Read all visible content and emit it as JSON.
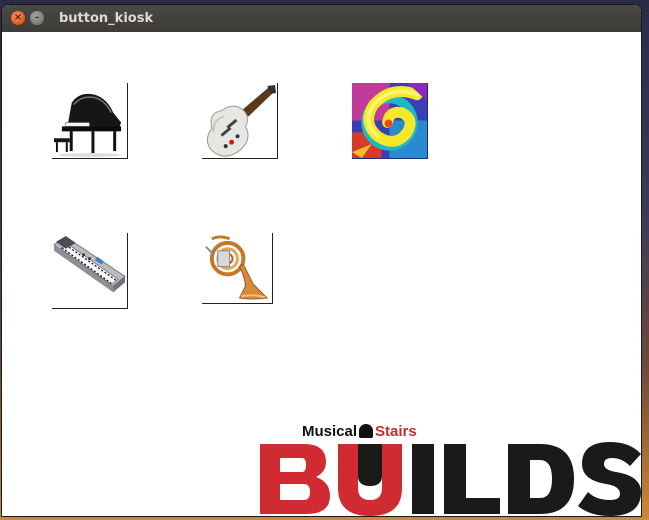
{
  "window": {
    "title": "button_kiosk",
    "close_glyph": "×",
    "minimize_glyph": "–"
  },
  "buttons": [
    {
      "icon": "grand-piano-icon"
    },
    {
      "icon": "electric-guitar-icon"
    },
    {
      "icon": "psychedelic-swirl-icon"
    },
    {
      "icon": "keyboard-synth-icon"
    },
    {
      "icon": "french-horn-icon"
    }
  ],
  "logo": {
    "tagline_part1": "Musical",
    "tagline_part2": "Stairs",
    "wordmark": "BUILDS",
    "colors": {
      "red": "#d02a32",
      "black": "#1a1a1a"
    }
  }
}
